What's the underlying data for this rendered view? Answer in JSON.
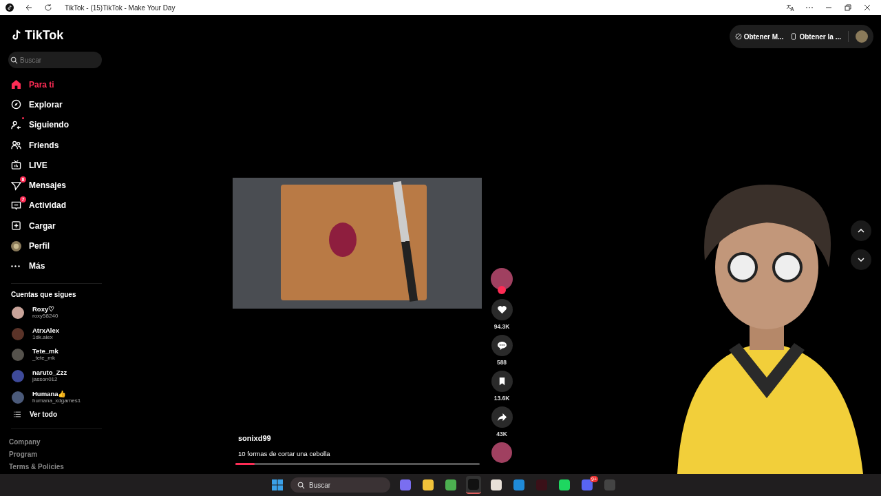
{
  "browser": {
    "title": "TikTok - (15)TikTok - Make Your Day"
  },
  "sidebar": {
    "logo": "TikTok",
    "search": {
      "placeholder": "Buscar"
    },
    "nav": [
      {
        "kind": "home",
        "label": "Para ti",
        "selected": true,
        "dot": false
      },
      {
        "kind": "compass",
        "label": "Explorar",
        "selected": false,
        "dot": false
      },
      {
        "kind": "following",
        "label": "Siguiendo",
        "selected": false,
        "dot": true
      },
      {
        "kind": "friends",
        "label": "Friends",
        "selected": false,
        "dot": false
      },
      {
        "kind": "live",
        "label": "LIVE",
        "selected": false,
        "dot": false
      },
      {
        "kind": "messages",
        "label": "Mensajes",
        "selected": false,
        "dot": false,
        "badge": "8"
      },
      {
        "kind": "activity",
        "label": "Actividad",
        "selected": false,
        "dot": false,
        "badge": "7"
      },
      {
        "kind": "upload",
        "label": "Cargar",
        "selected": false,
        "dot": false
      },
      {
        "kind": "profile",
        "label": "Perfil",
        "selected": false,
        "dot": false
      },
      {
        "kind": "more",
        "label": "Más",
        "selected": false,
        "dot": false
      }
    ],
    "following_heading": "Cuentas que sigues",
    "accounts": [
      {
        "name": "Roxy♡",
        "handle": "roxy58240",
        "color": "#c9a49a"
      },
      {
        "name": "AtrxAlex",
        "handle": "1dk.alex",
        "color": "#5a3328"
      },
      {
        "name": "Tete_mk",
        "handle": "_tete_mk",
        "color": "#55524c"
      },
      {
        "name": "naruto_Zzz",
        "handle": "jasson012",
        "color": "#3e4a9a"
      },
      {
        "name": "Humana👍",
        "handle": "humana_xdgames1",
        "color": "#4b5a7a"
      }
    ],
    "see_all": "Ver todo",
    "footer_links": [
      "Company",
      "Program",
      "Terms & Policies"
    ]
  },
  "top_actions": [
    {
      "kind": "coin",
      "label": "Obtener M..."
    },
    {
      "kind": "phone",
      "label": "Obtener la ..."
    }
  ],
  "video": {
    "author": "sonixd99",
    "caption": "10 formas de cortar una cebolla",
    "progress": {
      "level": 0.08
    },
    "actions": [
      {
        "kind": "like",
        "count": "94.3K"
      },
      {
        "kind": "comment",
        "count": "588"
      },
      {
        "kind": "save",
        "count": "13.6K"
      },
      {
        "kind": "share",
        "count": "43K"
      }
    ]
  },
  "taskbar": {
    "search": {
      "placeholder": "Buscar"
    },
    "apps": [
      {
        "kind": "copilot",
        "active": false
      },
      {
        "kind": "folder",
        "active": false
      },
      {
        "kind": "chrome",
        "active": false
      },
      {
        "kind": "tiktok",
        "active": true
      },
      {
        "kind": "minecraft",
        "active": false
      },
      {
        "kind": "edge",
        "active": false
      },
      {
        "kind": "m",
        "active": false
      },
      {
        "kind": "spotify",
        "active": false
      },
      {
        "kind": "discord",
        "active": false,
        "badge": "9+"
      },
      {
        "kind": "obs",
        "active": false
      }
    ]
  }
}
